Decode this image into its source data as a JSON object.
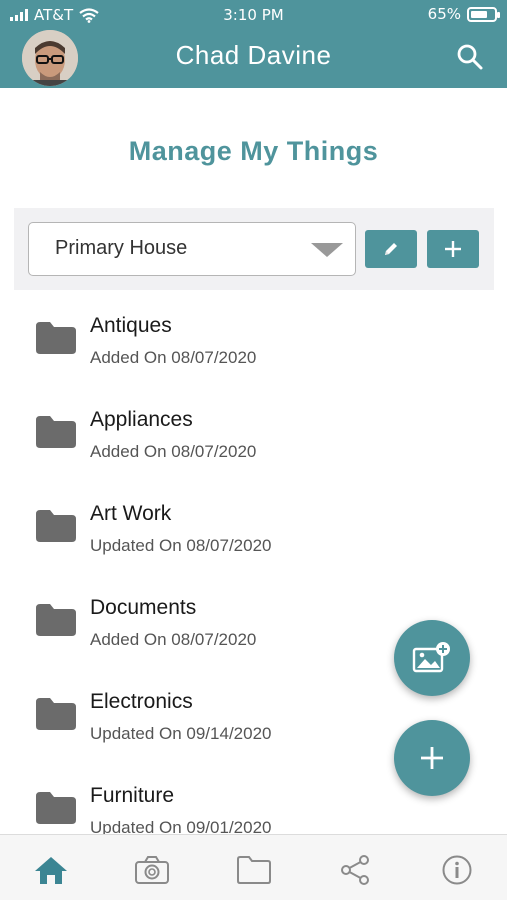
{
  "status_bar": {
    "carrier": "AT&T",
    "time": "3:10 PM",
    "battery": "65%"
  },
  "header": {
    "title": "Chad Davine",
    "avatar_icon": "user-avatar",
    "search_icon": "search-icon",
    "color": "#4f949c"
  },
  "page": {
    "title": "Manage My Things"
  },
  "selector": {
    "value": "Primary House",
    "edit_icon": "pencil-icon",
    "add_icon": "plus-icon"
  },
  "items": [
    {
      "name": "Antiques",
      "date": "Added On 08/07/2020"
    },
    {
      "name": "Appliances",
      "date": "Added On 08/07/2020"
    },
    {
      "name": "Art Work",
      "date": "Updated On 08/07/2020"
    },
    {
      "name": "Documents",
      "date": "Added On 08/07/2020"
    },
    {
      "name": "Electronics",
      "date": "Updated On 09/14/2020"
    },
    {
      "name": "Furniture",
      "date": "Updated On 09/01/2020"
    }
  ],
  "fabs": {
    "photo_icon": "add-photo-icon",
    "add_icon": "plus-icon"
  },
  "bottom_nav": [
    {
      "icon": "home-icon",
      "active": true
    },
    {
      "icon": "camera-icon",
      "active": false
    },
    {
      "icon": "folder-icon",
      "active": false
    },
    {
      "icon": "share-icon",
      "active": false
    },
    {
      "icon": "info-icon",
      "active": false
    }
  ]
}
